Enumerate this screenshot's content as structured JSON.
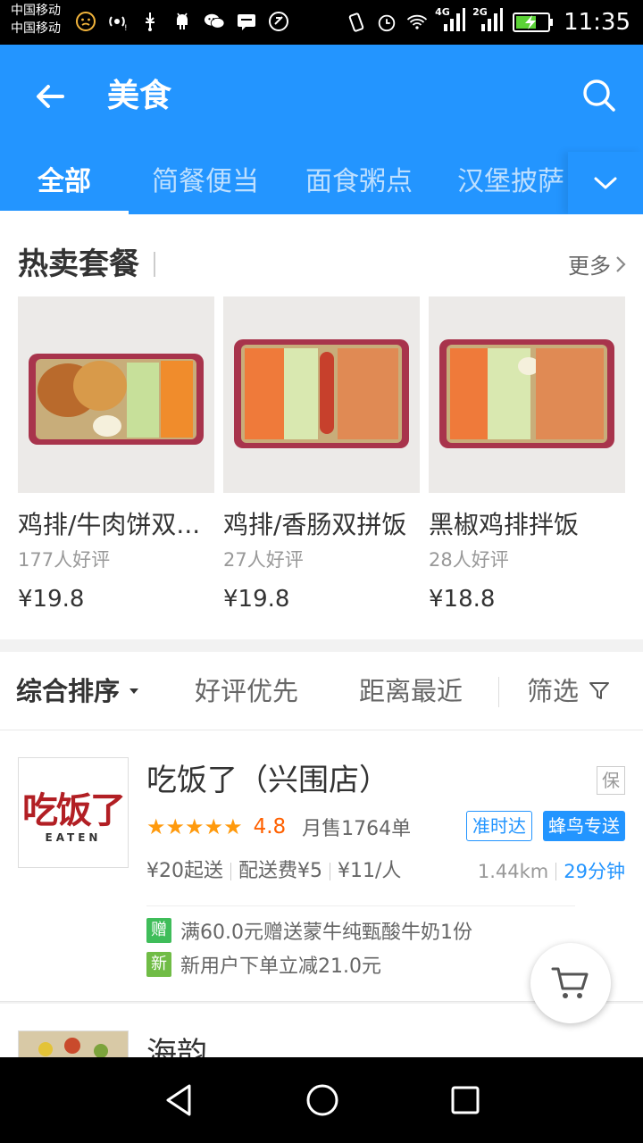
{
  "status_bar": {
    "carrier_1": "中国移动",
    "carrier_2": "中国移动",
    "net_4g": "4G",
    "net_2g": "2G",
    "time": "11:35"
  },
  "header": {
    "title": "美食",
    "tabs": [
      {
        "label": "全部",
        "active": true
      },
      {
        "label": "简餐便当",
        "active": false
      },
      {
        "label": "面食粥点",
        "active": false
      },
      {
        "label": "汉堡披萨",
        "active": false
      }
    ]
  },
  "hot_section": {
    "title": "热卖套餐",
    "more_label": "更多",
    "items": [
      {
        "name": "鸡排/牛肉饼双...",
        "reviews": "177人好评",
        "price": "¥19.8"
      },
      {
        "name": "鸡排/香肠双拼饭",
        "reviews": "27人好评",
        "price": "¥19.8"
      },
      {
        "name": "黑椒鸡排拌饭",
        "reviews": "28人好评",
        "price": "¥18.8"
      }
    ]
  },
  "sort_bar": {
    "items": [
      "综合排序",
      "好评优先",
      "距离最近"
    ],
    "filter_label": "筛选"
  },
  "shops": [
    {
      "name": "吃饭了（兴围店）",
      "logo_text": "吃饭了",
      "logo_subtext": "EATEN",
      "guarantee_badge": "保",
      "stars": "★★★★★",
      "rating": "4.8",
      "monthly_sales": "月售1764单",
      "tag_ontime": "准时达",
      "tag_delivery": "蜂鸟专送",
      "min_order": "¥20起送",
      "delivery_fee": "配送费¥5",
      "per_person": "¥11/人",
      "distance": "1.44km",
      "delivery_time": "29分钟",
      "promotions": [
        {
          "badge": "赠",
          "color": "#3fbd5a",
          "text": "满60.0元赠送蒙牛纯甄酸牛奶1份"
        },
        {
          "badge": "新",
          "color": "#70bc46",
          "text": "新用户下单立减21.0元"
        }
      ]
    },
    {
      "name": "海韵"
    }
  ],
  "colors": {
    "brand_blue": "#2395ff",
    "rating_orange": "#ff6000",
    "star_orange": "#ff9a0d"
  }
}
